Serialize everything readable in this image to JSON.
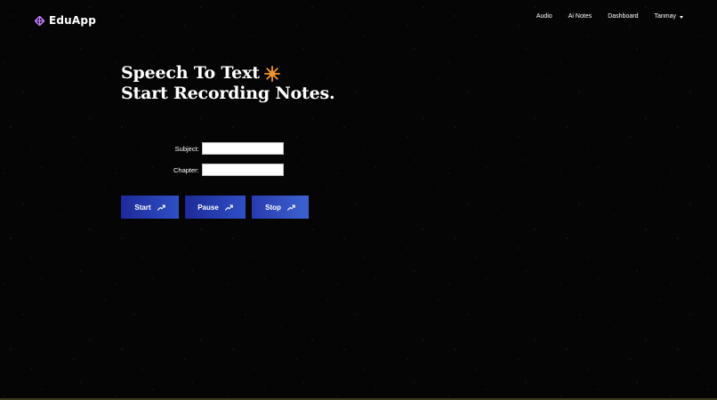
{
  "brand": {
    "name": "EduApp",
    "icon": "brand-logo-icon"
  },
  "nav": {
    "items": [
      {
        "label": "Audio"
      },
      {
        "label": "Ai Notes"
      },
      {
        "label": "Dashboard"
      }
    ],
    "user": {
      "label": "Tanmay",
      "icon": "caret-down-icon"
    }
  },
  "hero": {
    "line1": "Speech To Text",
    "line2": "Start Recording Notes.",
    "spark_icon": "sparkle-icon",
    "spark_color": "#f0932b"
  },
  "form": {
    "subject": {
      "label": "Subject:",
      "value": "",
      "placeholder": ""
    },
    "chapter": {
      "label": "Chapter:",
      "value": "",
      "placeholder": ""
    }
  },
  "controls": {
    "start_label": "Start",
    "pause_label": "Pause",
    "stop_label": "Stop",
    "icon": "trend-up-icon",
    "color_from": "#1d2a9a",
    "color_to": "#2f4fc4"
  },
  "colors": {
    "background": "#050505",
    "text": "#ffffff",
    "brand_icon": "#c77dff"
  }
}
